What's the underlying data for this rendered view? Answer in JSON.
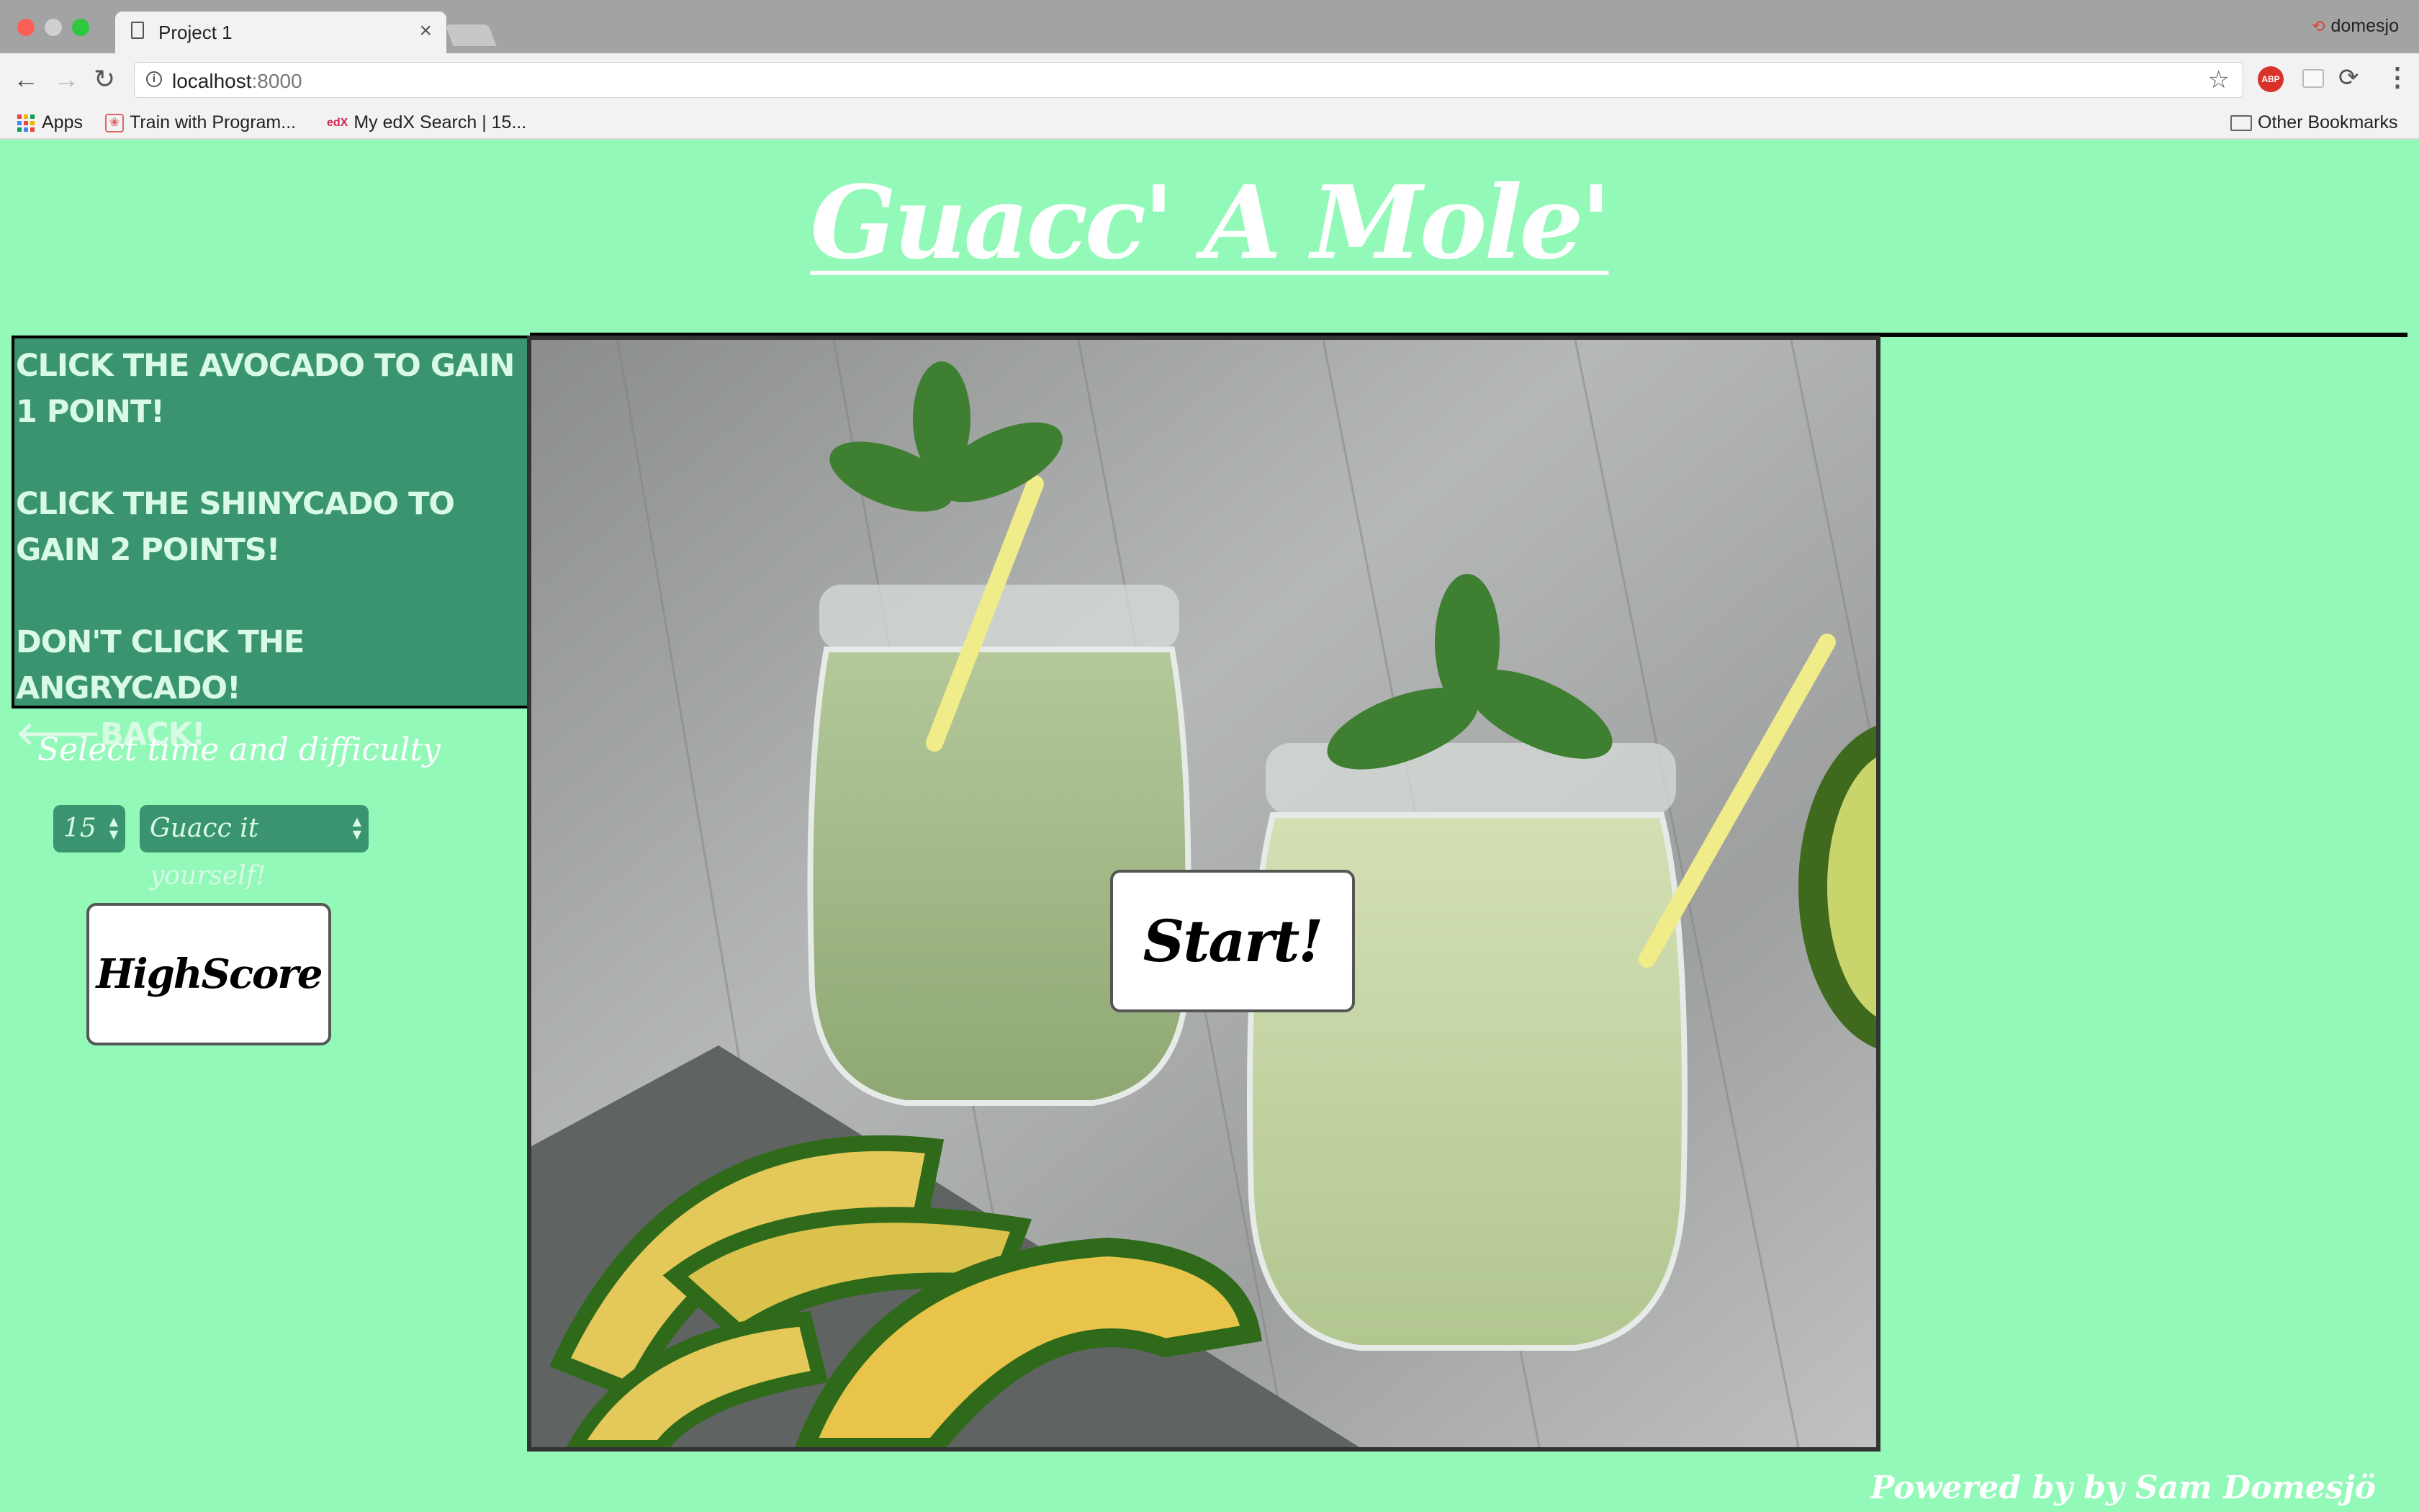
{
  "browser": {
    "tab_title": "Project 1",
    "tab_close": "×",
    "profile_name": "domesjo",
    "url_host": "localhost",
    "url_port": ":8000",
    "bookmarks": [
      {
        "label": "Apps"
      },
      {
        "label": "Train with Program..."
      },
      {
        "label": "My edX Search | 15..."
      }
    ],
    "other_bookmarks": "Other Bookmarks",
    "icons": [
      "back-icon",
      "forward-icon",
      "reload-icon",
      "info-icon",
      "star-icon",
      "adblock-icon",
      "sync-icon",
      "menu-icon"
    ]
  },
  "page": {
    "title": "Guacc' A Mole'",
    "rules": [
      "CLICK THE AVOCADO TO GAIN 1 POINT!",
      "CLICK THE SHINYCADO TO GAIN 2 POINTS!",
      "DON'T CLICK THE ANGRYCADO!"
    ],
    "back_label": "BACK!",
    "select_label": "Select time and difficulty",
    "time_value": "15",
    "difficulty_value": "Guacc it yourself!",
    "highscore_label": "HighScore",
    "start_label": "Start!",
    "footer": "Powered by by Sam Domesjö"
  },
  "colors": {
    "page_background": "#93f9b9",
    "panel_green": "#3b9470",
    "panel_text": "#d9fbe6"
  }
}
